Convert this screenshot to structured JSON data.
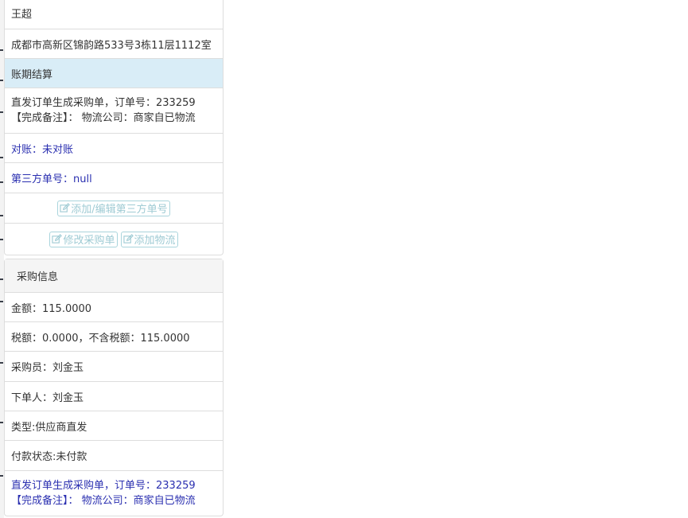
{
  "order": {
    "name": "王超",
    "address": "成都市高新区锦韵路533号3栋11层1112室",
    "billing": "账期结算",
    "note_line1": "直发订单生成采购单，订单号：233259",
    "note_line2": "【完成备注】： 物流公司：商家自已物流",
    "reconcile": "对账：未对账",
    "third_party": "第三方单号：null",
    "btn_edit_third": "添加/编辑第三方单号",
    "btn_modify_po": "修改采购单",
    "btn_add_logistics": "添加物流"
  },
  "purchase": {
    "heading": "采购信息",
    "amount": "金额：115.0000",
    "tax": "税额：0.0000，不含税额：115.0000",
    "buyer": "采购员：刘金玉",
    "orderer": "下单人：刘金玉",
    "type": "类型:供应商直发",
    "payment_status": "付款状态:未付款",
    "note_line1": "直发订单生成采购单，订单号：233259",
    "note_line2": "【完成备注】： 物流公司：商家自已物流"
  },
  "icons": {
    "button_icon": "edit-icon"
  },
  "colors": {
    "highlight": "#d9edf7",
    "link_blue": "#2a2fb0",
    "button_border": "#a9d4dc",
    "button_text": "#9fcbd4"
  }
}
